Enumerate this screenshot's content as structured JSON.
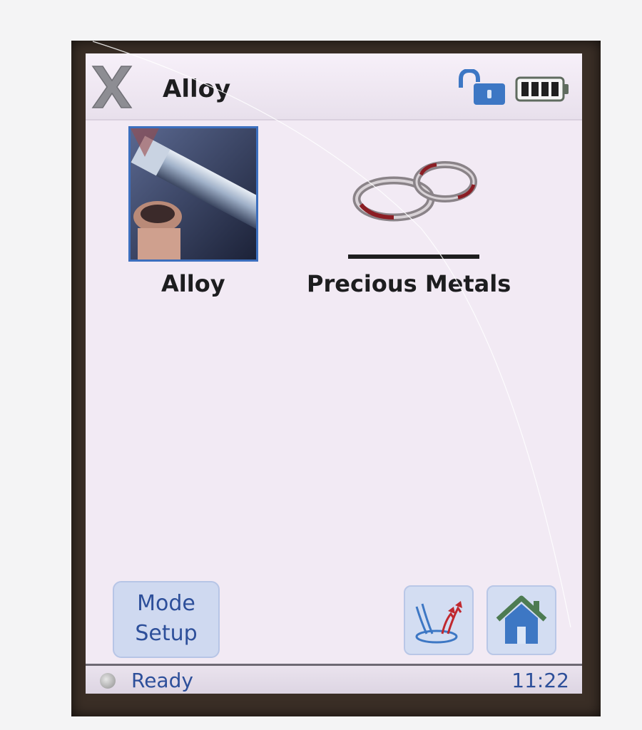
{
  "titlebar": {
    "logo_icon": "x-logo-icon",
    "title": "Alloy",
    "lock_icon": "unlocked-padlock-icon",
    "battery_icon": "battery-full-icon"
  },
  "tiles": [
    {
      "label": "Alloy",
      "icon": "alloy-bolt-photo-icon",
      "selected": true
    },
    {
      "label": "Precious Metals",
      "icon": "rings-icon",
      "selected": false
    }
  ],
  "buttons": {
    "mode_setup_line1": "Mode",
    "mode_setup_line2": "Setup",
    "shots_icon": "sample-shots-icon",
    "home_icon": "home-icon"
  },
  "status": {
    "text": "Ready",
    "time": "11:22"
  },
  "colors": {
    "accent_blue": "#3c6fbe",
    "text_blue": "#2d4f9a",
    "screen_bg": "#f2eaf4"
  }
}
